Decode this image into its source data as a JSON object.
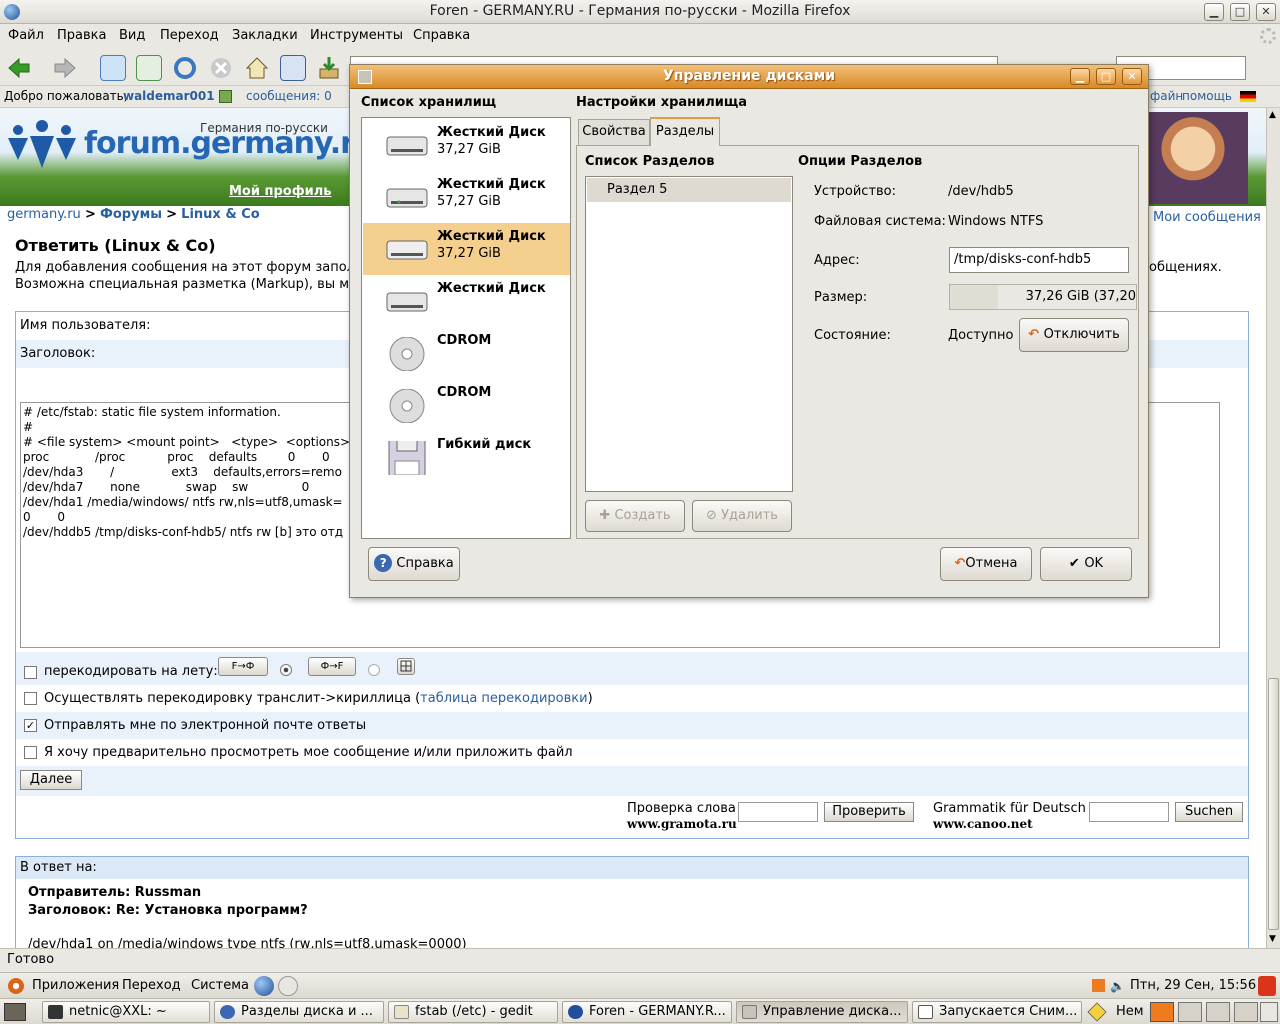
{
  "firefox": {
    "title": "Foren - GERMANY.RU - Германия по-русски - Mozilla Firefox",
    "menu": [
      "Файл",
      "Правка",
      "Вид",
      "Переход",
      "Закладки",
      "Инструменты",
      "Справка"
    ],
    "welcome": "Добро пожаловать,",
    "username": "waldemar001",
    "messages": "сообщения: 0",
    "top_links": [
      "файн",
      "помощь"
    ],
    "status": "Готово"
  },
  "site": {
    "tagline": "Германия по-русски",
    "logo": "forum.germany.ru",
    "nav_profile": "Мой профиль",
    "breadcrumb": [
      "germany.ru",
      "Форумы",
      "Linux & Co"
    ],
    "breadcrumb_sep": ">",
    "my_messages": "Мои сообщения",
    "reply_title": "Ответить (Linux & Co)",
    "intro_line1": "Для добавления сообщения на этот форум запол",
    "intro_line1_end": "общениях.",
    "intro_line2": "Возможна специальная разметка (Markup), вы мож",
    "username_label": "Имя пользователя:",
    "subject_label": "Заголовок:",
    "editor_lines": [
      "# /etc/fstab: static file system information.",
      "#",
      "# <file system> <mount point>   <type>  <options>",
      "proc            /proc           proc    defaults        0       0",
      "/dev/hda3       /               ext3    defaults,errors=remo",
      "/dev/hda7       none            swap    sw              0",
      "/dev/hda1 /media/windows/ ntfs rw,nls=utf8,umask=",
      "0       0",
      "/dev/hddb5 /tmp/disks-conf-hdb5/ ntfs rw [b] это отд"
    ],
    "recode_label": "перекодировать на лету:",
    "recode_btn1": "F→Ф",
    "recode_btn2": "Ф→F",
    "translit_label": "Осуществлять перекодировку транслит->кириллица (",
    "translit_link": "таблица перекодировки",
    "translit_close": ")",
    "email_label": "Отправлять мне по электронной почте ответы",
    "preview_label": "Я хочу предварительно просмотреть мое сообщение и/или приложить файл",
    "next_button": "Далее",
    "spell_label": "Проверка слова",
    "spell_site": "www.gramota.ru",
    "spell_button": "Проверить",
    "grammatik_label": "Grammatik für Deutsch",
    "grammatik_site": "www.canoo.net",
    "grammatik_button": "Suchen",
    "reply_to_header": "В ответ на:",
    "sender": "Отправитель: Russman",
    "subject": "Заголовок: Re: Установка программ?",
    "quote_line": "/dev/hda1 on /media/windows type ntfs (rw,nls=utf8,umask=0000)"
  },
  "dialog": {
    "title": "Управление дисками",
    "storage_list_title": "Список хранилищ",
    "storage_settings_title": "Настройки хранилища",
    "devices": [
      {
        "name": "Жесткий Диск",
        "size": "37,27 GiB",
        "icon": "hard-disk-icon"
      },
      {
        "name": "Жесткий Диск",
        "size": "57,27 GiB",
        "icon": "hard-disk-icon"
      },
      {
        "name": "Жесткий Диск",
        "size": "37,27 GiB",
        "icon": "hard-disk-icon"
      },
      {
        "name": "Жесткий Диск",
        "size": "",
        "icon": "hard-disk-icon"
      },
      {
        "name": "CDROM",
        "size": "",
        "icon": "cdrom-icon"
      },
      {
        "name": "CDROM",
        "size": "",
        "icon": "cdrom-icon"
      },
      {
        "name": "Гибкий диск",
        "size": "",
        "icon": "floppy-icon"
      }
    ],
    "selected_device_index": 2,
    "tabs": [
      "Свойства",
      "Разделы"
    ],
    "active_tab": "Разделы",
    "partition_list_title": "Список Разделов",
    "partitions": [
      "Раздел 5"
    ],
    "create_button": "Создать",
    "delete_button": "Удалить",
    "options_title": "Опции Разделов",
    "device_label": "Устройство:",
    "device_value": "/dev/hdb5",
    "fs_label": "Файловая система:",
    "fs_value": "Windows NTFS",
    "address_label": "Адрес:",
    "address_value": "/tmp/disks-conf-hdb5",
    "size_label": "Размер:",
    "size_value": "37,26 GiB (37,20",
    "state_label": "Состояние:",
    "state_value": "Доступно",
    "unmount_button": "Отключить",
    "help_button": "Справка",
    "cancel_button": "Отмена",
    "ok_button": "OK"
  },
  "panel": {
    "menus": [
      "Приложения",
      "Переход",
      "Система"
    ],
    "clock": "Птн, 29 Сен, 15:56",
    "keyboard": "Нем",
    "tasks": [
      "netnic@XXL: ~",
      "Разделы диска и ...",
      "fstab (/etc) - gedit",
      "Foren - GERMANY.R...",
      "Управление диска...",
      "Запускается Сним..."
    ],
    "active_task_index": 4
  }
}
